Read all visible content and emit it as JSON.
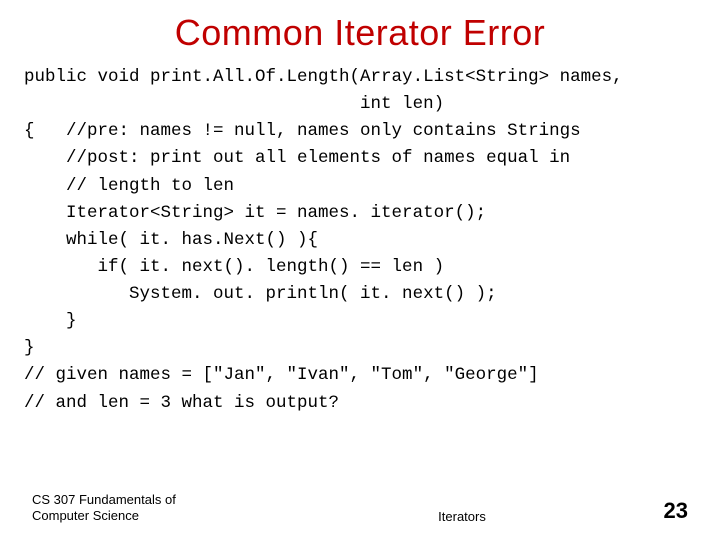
{
  "title": "Common Iterator Error",
  "code": "public void print.All.Of.Length(Array.List<String> names,\n                                int len)\n{   //pre: names != null, names only contains Strings\n    //post: print out all elements of names equal in\n    // length to len\n    Iterator<String> it = names. iterator();\n    while( it. has.Next() ){\n       if( it. next(). length() == len )\n          System. out. println( it. next() );\n    }\n}\n// given names = [\"Jan\", \"Ivan\", \"Tom\", \"George\"]\n// and len = 3 what is output?",
  "footer": {
    "left": "CS 307 Fundamentals of Computer Science",
    "center": "Iterators",
    "page": "23"
  }
}
